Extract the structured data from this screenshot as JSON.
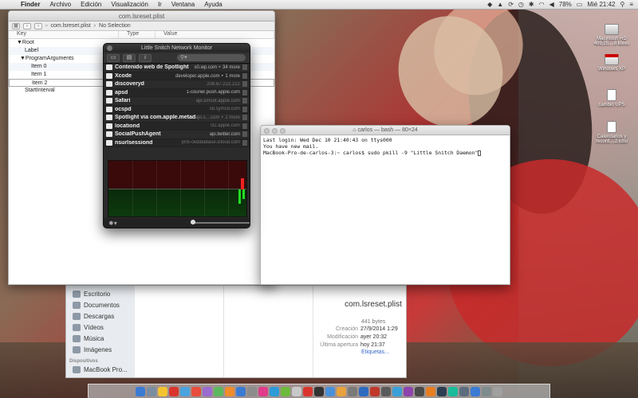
{
  "menubar": {
    "app": "Finder",
    "items": [
      "Archivo",
      "Edición",
      "Visualización",
      "Ir",
      "Ventana",
      "Ayuda"
    ],
    "battery": "78%",
    "clock": "Mié 21:42"
  },
  "plist_window": {
    "title": "com.lsreset.plist",
    "breadcrumb_file": "com.lsreset.plist",
    "breadcrumb_sel": "No Selection",
    "columns": [
      "Key",
      "Type",
      "Value"
    ],
    "rows": [
      {
        "key": "▼Root",
        "indent": 0
      },
      {
        "key": "Label",
        "indent": 1
      },
      {
        "key": "▼ProgramArguments",
        "indent": 1
      },
      {
        "key": "Item 0",
        "indent": 2
      },
      {
        "key": "Item 1",
        "indent": 2
      },
      {
        "key": "Item 2",
        "indent": 2
      },
      {
        "key": "StartInterval",
        "indent": 1
      }
    ]
  },
  "snitch": {
    "title": "Little Snitch Network Monitor",
    "rows": [
      {
        "app": "Contenido web de Spotlight",
        "server": "s0.wp.com ‣ 34 more",
        "dim": false
      },
      {
        "app": "Xcode",
        "server": "developer.apple.com ‣ 1 more",
        "dim": false
      },
      {
        "app": "discoveryd",
        "server": "208.67.222.222",
        "dim": true
      },
      {
        "app": "apsd",
        "server": "1-courier.push.apple.com",
        "dim": false
      },
      {
        "app": "Safari",
        "server": "api.smoot.apple.com",
        "dim": true
      },
      {
        "app": "ocspd",
        "server": "sb.symcd.com",
        "dim": true
      },
      {
        "app": "Spotlight via com.apple.metad...",
        "server": "api.s....com ‣ 1 more",
        "dim": true
      },
      {
        "app": "locationd",
        "server": "cl2.apple.com",
        "dim": true
      },
      {
        "app": "SocialPushAgent",
        "server": "api.twitter.com",
        "dim": false
      },
      {
        "app": "nsurlsessiond",
        "server": "p05-ckdatabase.icloud.com",
        "dim": true
      }
    ]
  },
  "terminal": {
    "title": "carlos — bash — 80×24",
    "lines": [
      "Last login: Wed Dec 10 21:40:43 on ttys000",
      "You have new mail.",
      "MacBook-Pro-de-carlos-3:~ carlos$ sudo pkill -9 \"Little Snitch Daemon\""
    ]
  },
  "finder": {
    "sidebar": [
      "Escritorio",
      "Documentos",
      "Descargas",
      "Vídeos",
      "Música",
      "Imágenes"
    ],
    "section_devices": "Dispositivos",
    "device": "MacBook Pro...",
    "preview_name": "com.lsreset.plist",
    "preview_size": "441 bytes",
    "meta": [
      {
        "label": "Creación",
        "value": "27/9/2014 1:29"
      },
      {
        "label": "Modificación",
        "value": "ayer 20:32"
      },
      {
        "label": "Última apertura",
        "value": "hoy 21:37"
      }
    ],
    "tags_link": "Etiquetas..."
  },
  "desktop_icons": [
    {
      "label": "Macintosh HD",
      "sub": "499,25....8 libres"
    },
    {
      "label": "Windows XP",
      "sub": ""
    },
    {
      "label": "cambio UPS",
      "sub": ""
    },
    {
      "label": "Calendarios y",
      "sub": "record....2.icbu"
    }
  ],
  "dock_colors": [
    "#3b7bd4",
    "#7b8da0",
    "#f4c430",
    "#d9352e",
    "#4aa3df",
    "#e84d3d",
    "#9a6bd1",
    "#5cb85c",
    "#f08c2c",
    "#3b7bd4",
    "#8c8c8c",
    "#e03c8a",
    "#2d9bd8",
    "#6dbb3c",
    "#c8c8c8",
    "#d9352e",
    "#333333",
    "#4a90d9",
    "#e8a23c",
    "#7a7a7a",
    "#2d6bbf",
    "#c0392b",
    "#5a5a5a",
    "#3aa0d8",
    "#8e44ad",
    "#4a4a4a",
    "#e67e22",
    "#2c3e50",
    "#1abc9c",
    "#5d6d7e",
    "#3b7bd4",
    "#7f8c8d",
    "#a0a0a0"
  ]
}
